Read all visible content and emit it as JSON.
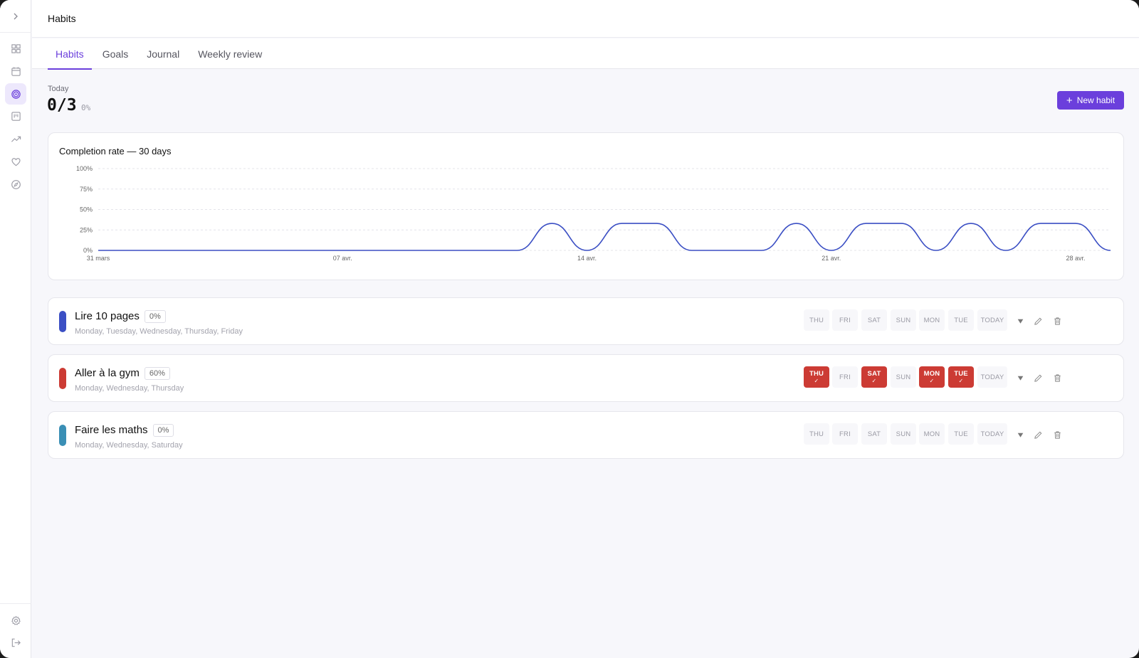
{
  "header": {
    "title": "Habits"
  },
  "tabs": [
    {
      "label": "Habits",
      "active": true
    },
    {
      "label": "Goals",
      "active": false
    },
    {
      "label": "Journal",
      "active": false
    },
    {
      "label": "Weekly review",
      "active": false
    }
  ],
  "sidebar": {
    "items": [
      {
        "icon": "dashboard-icon"
      },
      {
        "icon": "calendar-icon"
      },
      {
        "icon": "target-icon",
        "active": true
      },
      {
        "icon": "kanban-icon"
      },
      {
        "icon": "trending-up-icon"
      },
      {
        "icon": "heart-icon"
      },
      {
        "icon": "compass-icon"
      }
    ],
    "bottom": [
      {
        "icon": "settings-icon"
      },
      {
        "icon": "logout-icon"
      }
    ]
  },
  "today": {
    "label": "Today",
    "count": "0/3",
    "percent": "0%"
  },
  "new_habit_label": "New habit",
  "accent": "#6b3fdc",
  "chart_data": {
    "type": "line",
    "title": "Completion rate — 30 days",
    "ylim": [
      0,
      100
    ],
    "yticks": [
      "0%",
      "25%",
      "50%",
      "75%",
      "100%"
    ],
    "x_tick_labels": [
      "31 mars",
      "07 avr.",
      "14 avr.",
      "21 avr.",
      "28 avr."
    ],
    "grid": true,
    "series": [
      {
        "color": "#3b4fc4",
        "x": [
          "31 mars",
          "01 avr.",
          "02 avr.",
          "03 avr.",
          "04 avr.",
          "05 avr.",
          "06 avr.",
          "07 avr.",
          "08 avr.",
          "09 avr.",
          "10 avr.",
          "11 avr.",
          "12 avr.",
          "13 avr.",
          "14 avr.",
          "15 avr.",
          "16 avr.",
          "17 avr.",
          "18 avr.",
          "19 avr.",
          "20 avr.",
          "21 avr.",
          "22 avr.",
          "23 avr.",
          "24 avr.",
          "25 avr.",
          "26 avr.",
          "27 avr.",
          "28 avr.",
          "29 avr."
        ],
        "values": [
          0,
          0,
          0,
          0,
          0,
          0,
          0,
          0,
          0,
          0,
          0,
          0,
          0,
          33,
          0,
          33,
          33,
          0,
          0,
          0,
          33,
          0,
          33,
          33,
          0,
          33,
          0,
          33,
          33,
          0
        ]
      }
    ]
  },
  "weekday_labels": [
    "THU",
    "FRI",
    "SAT",
    "SUN",
    "MON",
    "TUE",
    "TODAY"
  ],
  "habits": [
    {
      "name": "Lire 10 pages",
      "percent": "0%",
      "days": "Monday, Tuesday, Wednesday, Thursday, Friday",
      "color": "#3b4fc4",
      "done": [
        false,
        false,
        false,
        false,
        false,
        false,
        false
      ]
    },
    {
      "name": "Aller à la gym",
      "percent": "60%",
      "days": "Monday, Wednesday, Thursday",
      "color": "#cc3b34",
      "done": [
        true,
        false,
        true,
        false,
        true,
        true,
        false
      ]
    },
    {
      "name": "Faire les maths",
      "percent": "0%",
      "days": "Monday, Wednesday, Saturday",
      "color": "#3a8fb5",
      "done": [
        false,
        false,
        false,
        false,
        false,
        false,
        false
      ]
    }
  ]
}
